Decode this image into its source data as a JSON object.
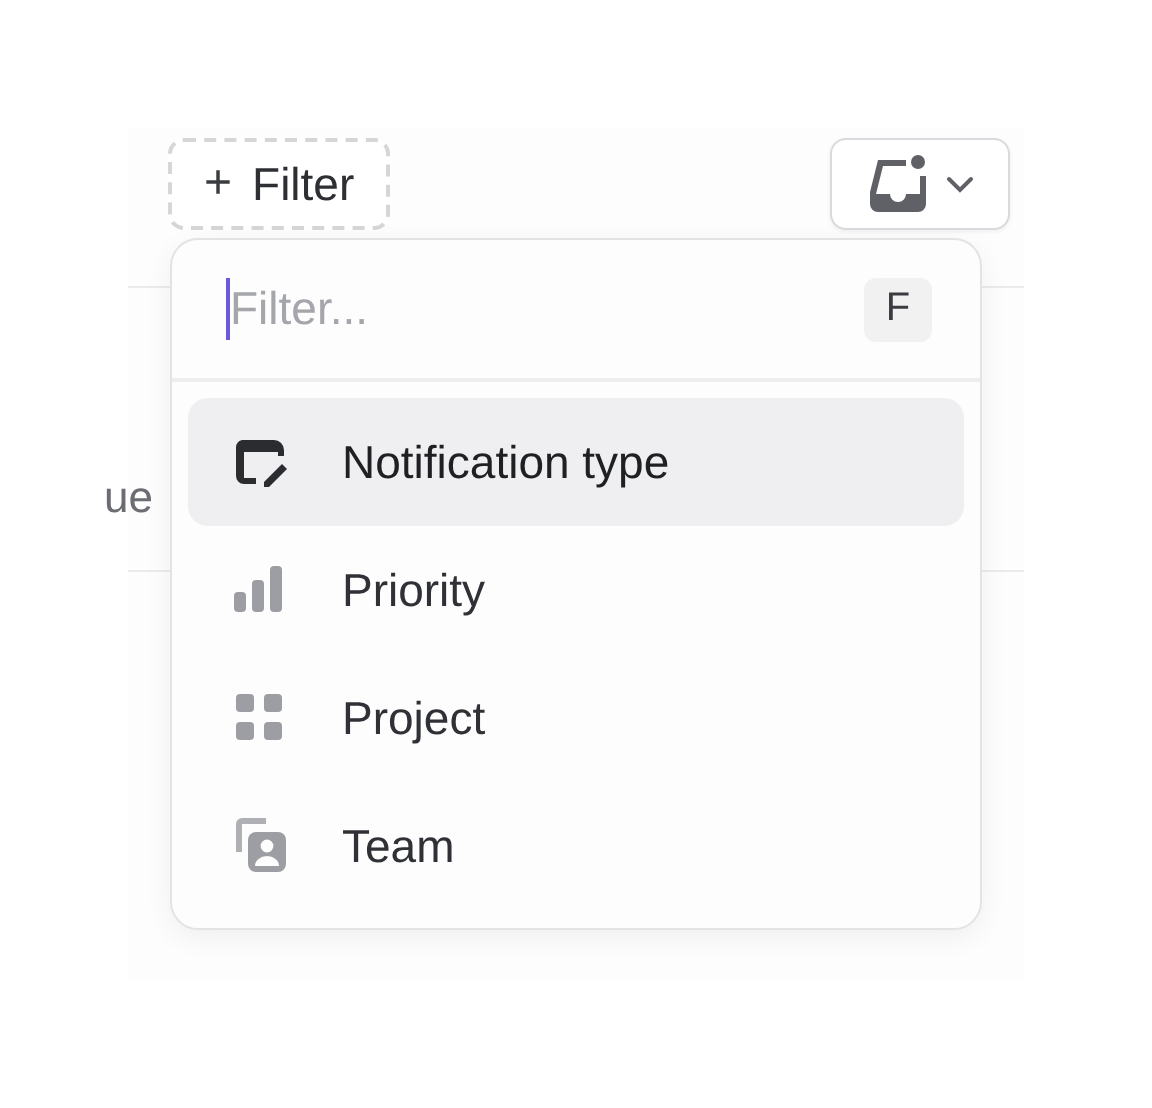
{
  "toolbar": {
    "filter_button": {
      "icon": "+",
      "label": "Filter"
    }
  },
  "background_text": "ue",
  "menu": {
    "search": {
      "placeholder": "Filter...",
      "shortcut": "F"
    },
    "items": [
      {
        "label": "Notification type",
        "kind": "notification",
        "selected": true
      },
      {
        "label": "Priority",
        "kind": "priority",
        "selected": false
      },
      {
        "label": "Project",
        "kind": "project",
        "selected": false
      },
      {
        "label": "Team",
        "kind": "team",
        "selected": false
      }
    ]
  }
}
